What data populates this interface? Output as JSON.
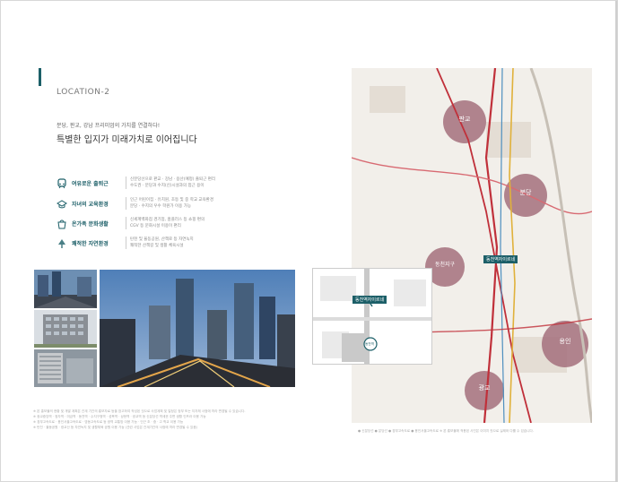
{
  "header": {
    "section_label": "LOCATION-2",
    "sub_headline": "분당, 판교, 강남 프리미엄의 가치를 연결하다!",
    "headline": "특별한 입지가 미래가치로 이어집니다"
  },
  "features": [
    {
      "icon": "subway-icon",
      "label": "여유로운 출퇴근",
      "desc": [
        "신분당선으로 판교 · 강남 · 용산(예정) 출퇴근 편리",
        "수도권 · 분당과 수지(신)시설과의 접근 용이"
      ]
    },
    {
      "icon": "school-icon",
      "label": "자녀의 교육환경",
      "desc": [
        "인근 어린이집 · 유치원, 초등 및 중 학교 교육환경",
        "분당 · 수지의 우수 학원가 이용 가능"
      ]
    },
    {
      "icon": "shopping-icon",
      "label": "온가족 문화생활",
      "desc": [
        "신세계백화점 경기점, 홈플러스 등 쇼핑 편의",
        "CGV 등 문화시설 이용이 편리"
      ]
    },
    {
      "icon": "tree-icon",
      "label": "쾌적한 자연환경",
      "desc": [
        "탄천 및 율동공원, 산책로 등 자연녹지",
        "쾌적한 산책길 및 생활 체육시설"
      ]
    }
  ],
  "inset": {
    "station_label": "동천역자이르네",
    "sign_label": "동천역"
  },
  "map": {
    "station_label": "동천역자이르네",
    "regions": [
      {
        "name": "판교"
      },
      {
        "name": "분당"
      },
      {
        "name": "동천지구"
      },
      {
        "name": "용인"
      },
      {
        "name": "광교"
      }
    ]
  },
  "disclaimer": [
    "※ 본 홍보물의 현황 및 개발 계획은 관계 기관의 홍보자료 등을 참고하여 작성된 것으로 사업계획 및 일정은 정부 또는 지자체 사정에 따라 변경될 수 있습니다.",
    "※ 광교중앙역 · 정자역 · 미금역 · 동천역 · 수지구청역 · 성복역 · 상현역 · 광교역 등 신분당선 역세권 주변 생활 인프라 이용 가능",
    "※ 경부고속도로 · 용인서울고속도로 · 영동고속도로 등 광역 교통망 이용 가능 · 인근 초 · 중 · 고 학교 이용 가능",
    "※ 탄천 · 율동공원 · 광교산 등 자연녹지 및 생활체육 공원 이용 가능 (관련 사업은 관계기관의 사정에 따라 변경될 수 있음)"
  ],
  "legend": "● 신분당선  ● 분당선  ● 경부고속도로  ● 용인서울고속도로    ※ 본 홍보물에 적용된 사진은 이미지 컷으로 실제와 다를 수 있습니다.",
  "colors": {
    "accent": "#1c5f68",
    "route_red": "#c0303a",
    "region": "#a4707c"
  }
}
